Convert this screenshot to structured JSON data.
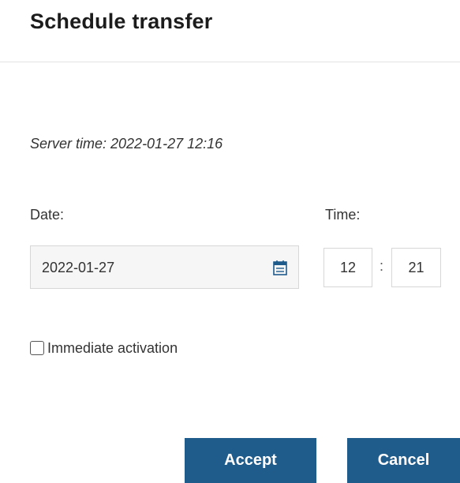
{
  "dialog": {
    "title": "Schedule transfer",
    "server_time": "Server time: 2022-01-27 12:16",
    "date_label": "Date:",
    "date_value": "2022-01-27",
    "time_label": "Time:",
    "hour_value": "12",
    "time_separator": ":",
    "minute_value": "21",
    "checkbox_label": "Immediate activation",
    "checkbox_checked": false,
    "accept_label": "Accept",
    "cancel_label": "Cancel"
  },
  "icons": {
    "date_picker": "calendar-icon"
  },
  "colors": {
    "primary_button": "#1f5c8c",
    "calendar_icon": "#1f5c8c"
  }
}
